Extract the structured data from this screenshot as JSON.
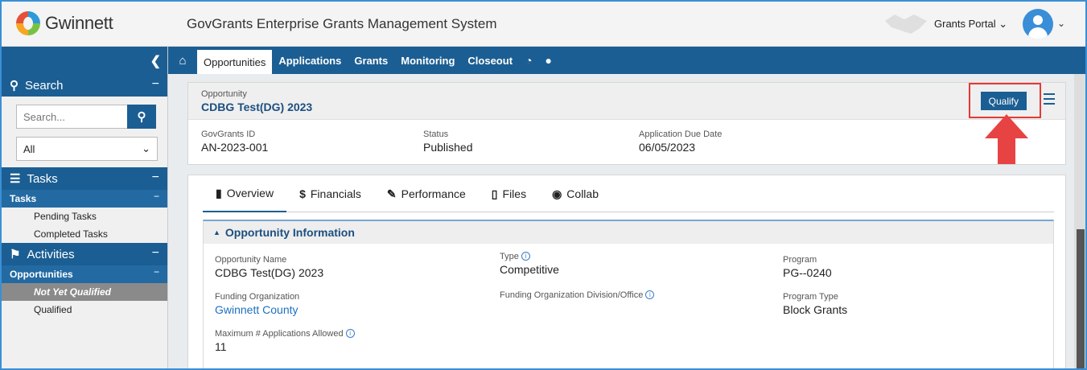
{
  "header": {
    "logo_text": "Gwinnett",
    "app_title": "GovGrants Enterprise Grants Management System",
    "portal_label": "Grants Portal",
    "portal_caret": "⌄",
    "avatar_caret": "⌄"
  },
  "nav": {
    "items": [
      {
        "label": "Opportunities",
        "active": true
      },
      {
        "label": "Applications"
      },
      {
        "label": "Grants"
      },
      {
        "label": "Monitoring"
      },
      {
        "label": "Closeout"
      }
    ]
  },
  "sidebar": {
    "search_title": "Search",
    "search_placeholder": "Search...",
    "filter_value": "All",
    "tasks_title": "Tasks",
    "tasks_sub": "Tasks",
    "pending": "Pending Tasks",
    "completed": "Completed Tasks",
    "activities_title": "Activities",
    "opps_sub": "Opportunities",
    "not_qualified": "Not Yet Qualified",
    "qualified": "Qualified",
    "minus": "−"
  },
  "opportunity": {
    "label": "Opportunity",
    "name": "CDBG Test(DG) 2023",
    "qualify_label": "Qualify",
    "fields": {
      "id_label": "GovGrants ID",
      "id_value": "AN-2023-001",
      "status_label": "Status",
      "status_value": "Published",
      "due_label": "Application Due Date",
      "due_value": "06/05/2023"
    }
  },
  "tabs": {
    "overview": "Overview",
    "financials": "Financials",
    "performance": "Performance",
    "files": "Files",
    "collab": "Collab"
  },
  "panel": {
    "title": "Opportunity Information",
    "opp_name_label": "Opportunity Name",
    "opp_name_value": "CDBG Test(DG) 2023",
    "type_label": "Type",
    "type_value": "Competitive",
    "program_label": "Program",
    "program_value": "PG--0240",
    "funding_org_label": "Funding Organization",
    "funding_org_value": "Gwinnett County",
    "division_label": "Funding Organization Division/Office",
    "program_type_label": "Program Type",
    "program_type_value": "Block Grants",
    "max_apps_label": "Maximum # Applications Allowed",
    "max_apps_value": "11"
  },
  "colors": {
    "primary": "#1b5e93",
    "highlight": "#e53935",
    "link": "#1d70c0"
  }
}
